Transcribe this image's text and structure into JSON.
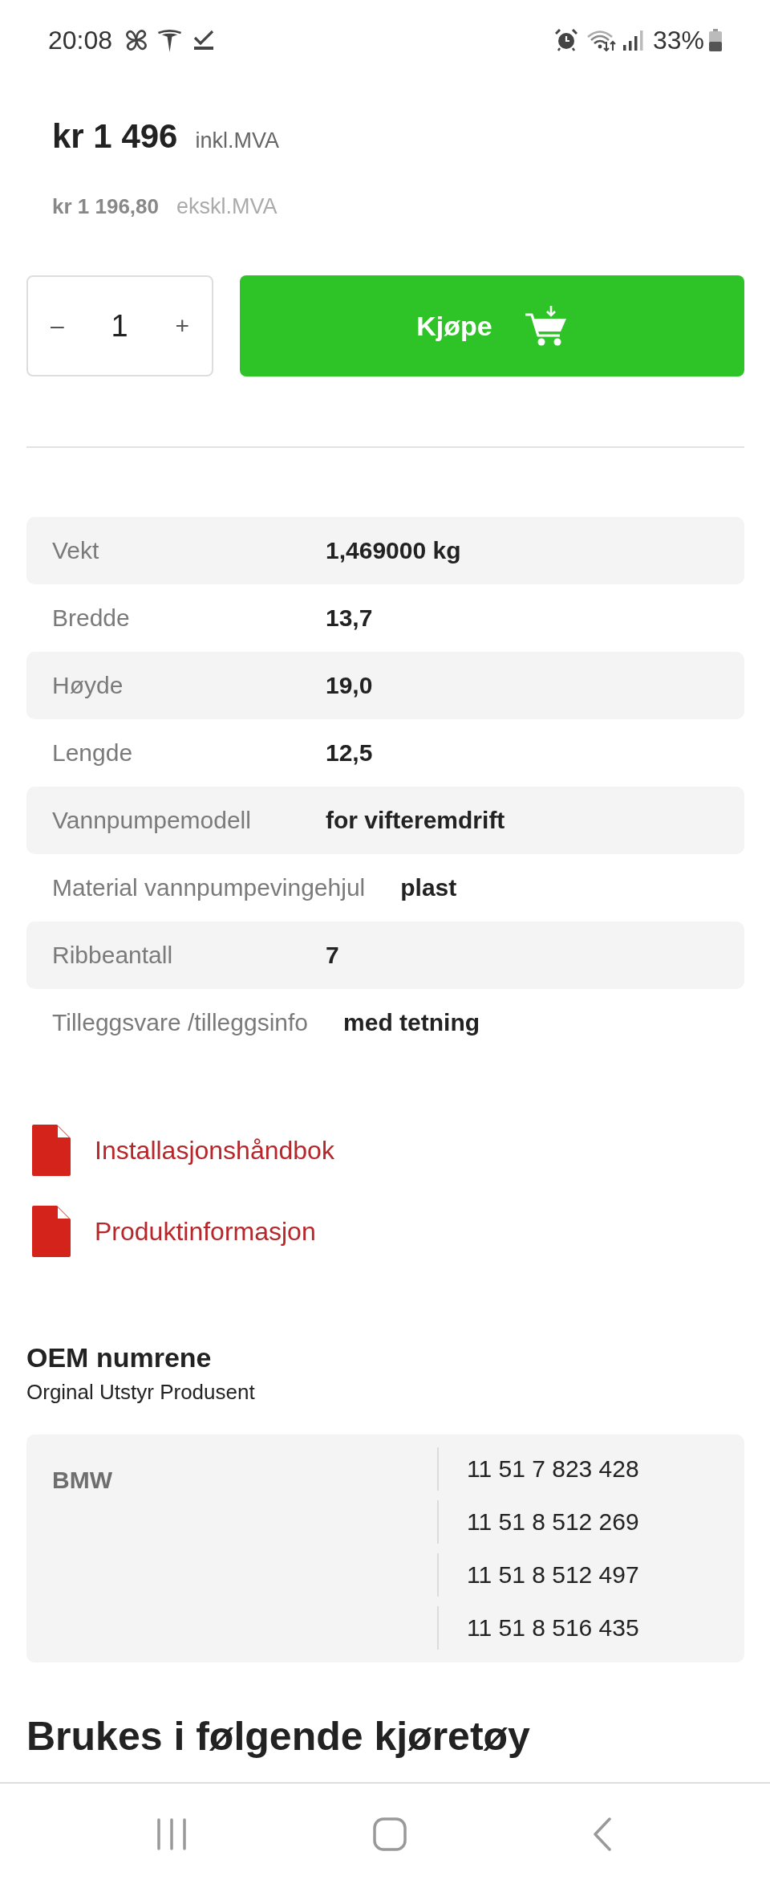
{
  "status_bar": {
    "time": "20:08",
    "battery_percent": "33%"
  },
  "price": {
    "amount_incl": "kr 1 496",
    "label_incl": "inkl.MVA",
    "amount_excl": "kr 1 196,80",
    "label_excl": "ekskl.MVA"
  },
  "purchase": {
    "decrement": "–",
    "quantity": "1",
    "increment": "+",
    "buy_label": "Kjøpe"
  },
  "specs": [
    {
      "label": "Vekt",
      "value": "1,469000 kg"
    },
    {
      "label": "Bredde",
      "value": "13,7"
    },
    {
      "label": "Høyde",
      "value": "19,0"
    },
    {
      "label": "Lengde",
      "value": "12,5"
    },
    {
      "label": "Vannpumpemodell",
      "value": "for vifteremdrift"
    },
    {
      "label": "Material vannpumpevingehjul",
      "value": "plast"
    },
    {
      "label": "Ribbeantall",
      "value": "7"
    },
    {
      "label": "Tilleggsvare /tilleggsinfo",
      "value": "med tetning"
    }
  ],
  "documents": [
    {
      "label": "Installasjonshåndbok"
    },
    {
      "label": "Produktinformasjon"
    }
  ],
  "oem": {
    "title": "OEM numrene",
    "subtitle": "Orginal Utstyr Produsent",
    "manufacturers": [
      {
        "name": "BMW",
        "numbers": [
          "11 51 7 823 428",
          "11 51 8 512 269",
          "11 51 8 512 497",
          "11 51 8 516 435"
        ]
      }
    ]
  },
  "vehicles_section": {
    "title": "Brukes i følgende kjøretøy"
  }
}
